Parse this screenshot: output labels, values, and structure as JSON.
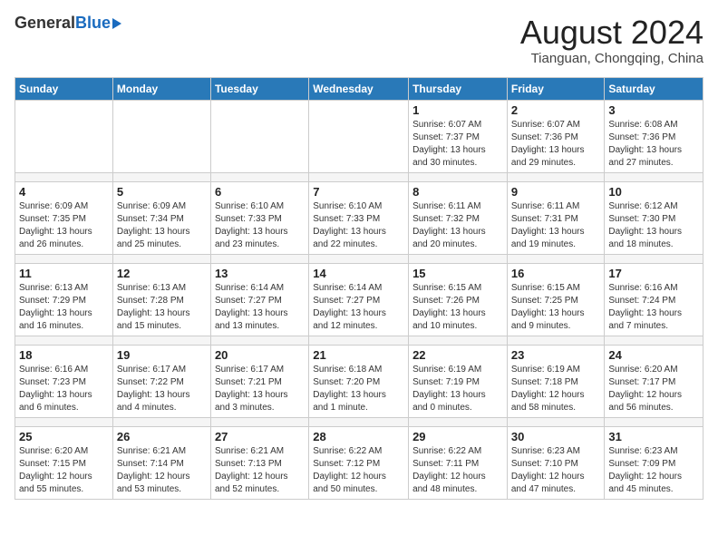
{
  "header": {
    "logo_general": "General",
    "logo_blue": "Blue",
    "main_title": "August 2024",
    "subtitle": "Tianguan, Chongqing, China"
  },
  "weekdays": [
    "Sunday",
    "Monday",
    "Tuesday",
    "Wednesday",
    "Thursday",
    "Friday",
    "Saturday"
  ],
  "weeks": [
    [
      {
        "day": "",
        "info": ""
      },
      {
        "day": "",
        "info": ""
      },
      {
        "day": "",
        "info": ""
      },
      {
        "day": "",
        "info": ""
      },
      {
        "day": "1",
        "info": "Sunrise: 6:07 AM\nSunset: 7:37 PM\nDaylight: 13 hours\nand 30 minutes."
      },
      {
        "day": "2",
        "info": "Sunrise: 6:07 AM\nSunset: 7:36 PM\nDaylight: 13 hours\nand 29 minutes."
      },
      {
        "day": "3",
        "info": "Sunrise: 6:08 AM\nSunset: 7:36 PM\nDaylight: 13 hours\nand 27 minutes."
      }
    ],
    [
      {
        "day": "4",
        "info": "Sunrise: 6:09 AM\nSunset: 7:35 PM\nDaylight: 13 hours\nand 26 minutes."
      },
      {
        "day": "5",
        "info": "Sunrise: 6:09 AM\nSunset: 7:34 PM\nDaylight: 13 hours\nand 25 minutes."
      },
      {
        "day": "6",
        "info": "Sunrise: 6:10 AM\nSunset: 7:33 PM\nDaylight: 13 hours\nand 23 minutes."
      },
      {
        "day": "7",
        "info": "Sunrise: 6:10 AM\nSunset: 7:33 PM\nDaylight: 13 hours\nand 22 minutes."
      },
      {
        "day": "8",
        "info": "Sunrise: 6:11 AM\nSunset: 7:32 PM\nDaylight: 13 hours\nand 20 minutes."
      },
      {
        "day": "9",
        "info": "Sunrise: 6:11 AM\nSunset: 7:31 PM\nDaylight: 13 hours\nand 19 minutes."
      },
      {
        "day": "10",
        "info": "Sunrise: 6:12 AM\nSunset: 7:30 PM\nDaylight: 13 hours\nand 18 minutes."
      }
    ],
    [
      {
        "day": "11",
        "info": "Sunrise: 6:13 AM\nSunset: 7:29 PM\nDaylight: 13 hours\nand 16 minutes."
      },
      {
        "day": "12",
        "info": "Sunrise: 6:13 AM\nSunset: 7:28 PM\nDaylight: 13 hours\nand 15 minutes."
      },
      {
        "day": "13",
        "info": "Sunrise: 6:14 AM\nSunset: 7:27 PM\nDaylight: 13 hours\nand 13 minutes."
      },
      {
        "day": "14",
        "info": "Sunrise: 6:14 AM\nSunset: 7:27 PM\nDaylight: 13 hours\nand 12 minutes."
      },
      {
        "day": "15",
        "info": "Sunrise: 6:15 AM\nSunset: 7:26 PM\nDaylight: 13 hours\nand 10 minutes."
      },
      {
        "day": "16",
        "info": "Sunrise: 6:15 AM\nSunset: 7:25 PM\nDaylight: 13 hours\nand 9 minutes."
      },
      {
        "day": "17",
        "info": "Sunrise: 6:16 AM\nSunset: 7:24 PM\nDaylight: 13 hours\nand 7 minutes."
      }
    ],
    [
      {
        "day": "18",
        "info": "Sunrise: 6:16 AM\nSunset: 7:23 PM\nDaylight: 13 hours\nand 6 minutes."
      },
      {
        "day": "19",
        "info": "Sunrise: 6:17 AM\nSunset: 7:22 PM\nDaylight: 13 hours\nand 4 minutes."
      },
      {
        "day": "20",
        "info": "Sunrise: 6:17 AM\nSunset: 7:21 PM\nDaylight: 13 hours\nand 3 minutes."
      },
      {
        "day": "21",
        "info": "Sunrise: 6:18 AM\nSunset: 7:20 PM\nDaylight: 13 hours\nand 1 minute."
      },
      {
        "day": "22",
        "info": "Sunrise: 6:19 AM\nSunset: 7:19 PM\nDaylight: 13 hours\nand 0 minutes."
      },
      {
        "day": "23",
        "info": "Sunrise: 6:19 AM\nSunset: 7:18 PM\nDaylight: 12 hours\nand 58 minutes."
      },
      {
        "day": "24",
        "info": "Sunrise: 6:20 AM\nSunset: 7:17 PM\nDaylight: 12 hours\nand 56 minutes."
      }
    ],
    [
      {
        "day": "25",
        "info": "Sunrise: 6:20 AM\nSunset: 7:15 PM\nDaylight: 12 hours\nand 55 minutes."
      },
      {
        "day": "26",
        "info": "Sunrise: 6:21 AM\nSunset: 7:14 PM\nDaylight: 12 hours\nand 53 minutes."
      },
      {
        "day": "27",
        "info": "Sunrise: 6:21 AM\nSunset: 7:13 PM\nDaylight: 12 hours\nand 52 minutes."
      },
      {
        "day": "28",
        "info": "Sunrise: 6:22 AM\nSunset: 7:12 PM\nDaylight: 12 hours\nand 50 minutes."
      },
      {
        "day": "29",
        "info": "Sunrise: 6:22 AM\nSunset: 7:11 PM\nDaylight: 12 hours\nand 48 minutes."
      },
      {
        "day": "30",
        "info": "Sunrise: 6:23 AM\nSunset: 7:10 PM\nDaylight: 12 hours\nand 47 minutes."
      },
      {
        "day": "31",
        "info": "Sunrise: 6:23 AM\nSunset: 7:09 PM\nDaylight: 12 hours\nand 45 minutes."
      }
    ]
  ]
}
